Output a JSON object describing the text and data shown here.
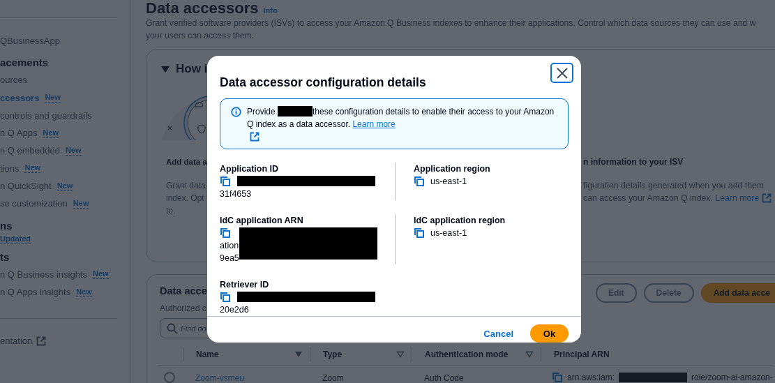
{
  "sidebar": {
    "groups": [
      {
        "items": [
          {
            "label": "QBusinessApp",
            "selected": false
          }
        ]
      },
      {
        "heading": "acements",
        "items": [
          {
            "label": "ources",
            "selected": false
          },
          {
            "label": "ccessors",
            "badge": "New",
            "selected": true
          },
          {
            "label": "controls and guardrails",
            "selected": false
          },
          {
            "label": "n Q Apps",
            "badge": "New",
            "selected": false
          },
          {
            "label": "n Q embedded",
            "badge": "New",
            "selected": false
          },
          {
            "label": "tions",
            "badge": "New",
            "selected": false
          },
          {
            "label": "n QuickSight",
            "badge": "New",
            "selected": false
          },
          {
            "label": "se customization",
            "badge": "New",
            "selected": false
          }
        ]
      },
      {
        "heading": "ns",
        "items": [
          {
            "badge": "Updated",
            "selected": false
          }
        ]
      },
      {
        "heading": "ts",
        "items": [
          {
            "label": "n Q Business insights",
            "badge": "New",
            "selected": false
          },
          {
            "label": "n Q Apps insights",
            "badge": "New",
            "selected": false
          }
        ]
      }
    ],
    "footer_link": "entation"
  },
  "page": {
    "title": "Data accessors",
    "info": "Info",
    "description": [
      "Grant verified software providers (ISVs) to access your Amazon Q Business indexes to enhance their applications. Control which data sources they can use and w",
      "your users can access them."
    ]
  },
  "how_it_works": {
    "title": "How i",
    "expanded": true,
    "steps": [
      {
        "title": "Add data a",
        "lines": [
          "Grant data",
          "index. Opt",
          "to."
        ]
      },
      {
        "title": "n information to your ISV",
        "lines": [
          "figuration details generated when you add them",
          "can access your Amazon Q index."
        ],
        "link": "Learn more"
      }
    ]
  },
  "accessors_table": {
    "title": "Data acce",
    "subtitle": "Authorized c",
    "search": {
      "placeholder": "Find do"
    },
    "buttons": [
      {
        "label": "Edit",
        "kind": "normal",
        "disabled": true
      },
      {
        "label": "Delete",
        "kind": "normal",
        "disabled": true
      },
      {
        "label": "Add data acce",
        "kind": "primary",
        "disabled": false
      }
    ],
    "columns": [
      {
        "label": "Name",
        "sorted": true
      },
      {
        "label": "Type",
        "sorted": false
      },
      {
        "label": "Authentication mode",
        "sorted": false
      },
      {
        "label": "Principal ARN"
      }
    ],
    "rows": [
      {
        "selected": false,
        "name": "Zoom-vsmeu",
        "type": "Zoom",
        "auth": "Auth Code",
        "arn_start": "arn:aws:iam:",
        "arn_end": "role/zoom-ai-amazon-",
        "redacted": true
      }
    ]
  },
  "modal": {
    "title": "Data accessor configuration details",
    "alert": {
      "before": "Provide ",
      "redacted": true,
      "after": "these configuration details to enable their access to your Amazon Q index as a data accessor.",
      "link": "Learn more"
    },
    "fields": [
      {
        "label": "Application ID",
        "redacted": true,
        "redacted_multiline": false,
        "lines": [
          "31f4653"
        ]
      },
      {
        "label": "Application region",
        "value": "us-east-1"
      },
      {
        "label": "IdC application ARN",
        "redacted": true,
        "redacted_multiline": true,
        "lines": [
          "ation",
          "9ea5"
        ]
      },
      {
        "label": "IdC application region",
        "value": "us-east-1"
      },
      {
        "label": "Retriever ID",
        "redacted": true,
        "redacted_multiline": false,
        "lines": [
          "20e2d6"
        ]
      }
    ],
    "buttons": [
      {
        "label": "Cancel",
        "kind": "link"
      },
      {
        "label": "Ok",
        "kind": "primary"
      }
    ]
  }
}
